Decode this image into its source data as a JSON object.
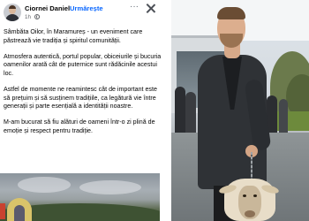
{
  "post": {
    "author": "Ciornei Daniel",
    "separator": "·",
    "follow_label": "Urmărește",
    "time": "1h",
    "icons": {
      "audience": "globe-icon",
      "more": "more-options-icon",
      "close": "close-icon"
    },
    "paragraphs": [
      "Sâmbăta Oilor, în Maramureș - un eveniment care păstrează vie tradiția și spiritul comunității.",
      "Atmosfera autentică, portul popular, obiceiurile și bucuria oamenilor arată cât de puternice sunt rădăcinile acestui loc.",
      "Astfel de momente ne reamintesc cât de important este să prețuim și să susținem tradițiile, ca legătură vie între generații și parte esențială a identității noastre.",
      "M-am bucurat să fiu alături de oameni într-o zi plină de emoție și respect pentru tradiție."
    ],
    "more_glyph": "···"
  },
  "colors": {
    "follow_link": "#0866ff",
    "text_primary": "#050505",
    "text_secondary": "#65676b"
  }
}
